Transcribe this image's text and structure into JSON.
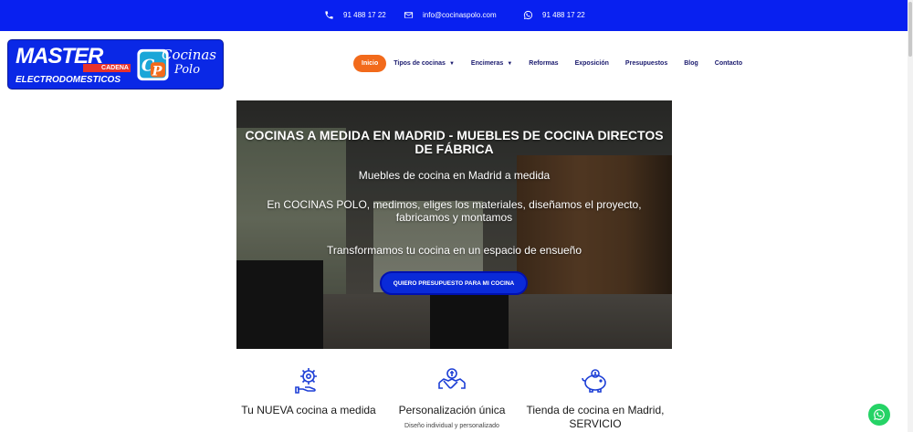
{
  "topbar": {
    "phone1": "91 488 17 22",
    "email": "info@cocinaspolo.com",
    "whatsapp": "91 488 17 22",
    "bg_color": "#0820f0"
  },
  "logo": {
    "master": "MASTER",
    "cadena": "CADENA",
    "electrodomesticos": "ELECTRODOMESTICOS",
    "cp_mark": "CP",
    "cocinas": "Cocinas",
    "polo": "Polo"
  },
  "nav": {
    "items": [
      {
        "label": "Inicio",
        "active": true
      },
      {
        "label": "Tipos de cocinas",
        "dropdown": true
      },
      {
        "label": "Encimeras",
        "dropdown": true
      },
      {
        "label": "Reformas"
      },
      {
        "label": "Exposición"
      },
      {
        "label": "Presupuestos"
      },
      {
        "label": "Blog"
      },
      {
        "label": "Contacto"
      }
    ],
    "active_color": "#f26a1b"
  },
  "hero": {
    "title": "COCINAS A MEDIDA EN MADRID - MUEBLES DE COCINA DIRECTOS DE FÁBRICA",
    "subtitle": "Muebles de cocina en Madrid a medida",
    "body": "En COCINAS POLO, medimos, eliges los materiales, diseñamos el proyecto, fabricamos y montamos",
    "tagline": "Transformamos tu cocina en un espacio de ensueño",
    "cta": "QUIERO PRESUPUESTO PARA MI COCINA"
  },
  "features": [
    {
      "icon": "gear-hand-icon",
      "title": "Tu NUEVA cocina a medida",
      "desc": ""
    },
    {
      "icon": "handshake-icon",
      "title": "Personalización única",
      "desc": "Diseño individual y personalizado"
    },
    {
      "icon": "piggy-bank-icon",
      "title": "Tienda de cocina en Madrid, SERVICIO",
      "desc": ""
    }
  ],
  "colors": {
    "brand_blue": "#0a28e6",
    "icon_blue": "#1d3fd6",
    "whatsapp_green": "#25d366"
  }
}
